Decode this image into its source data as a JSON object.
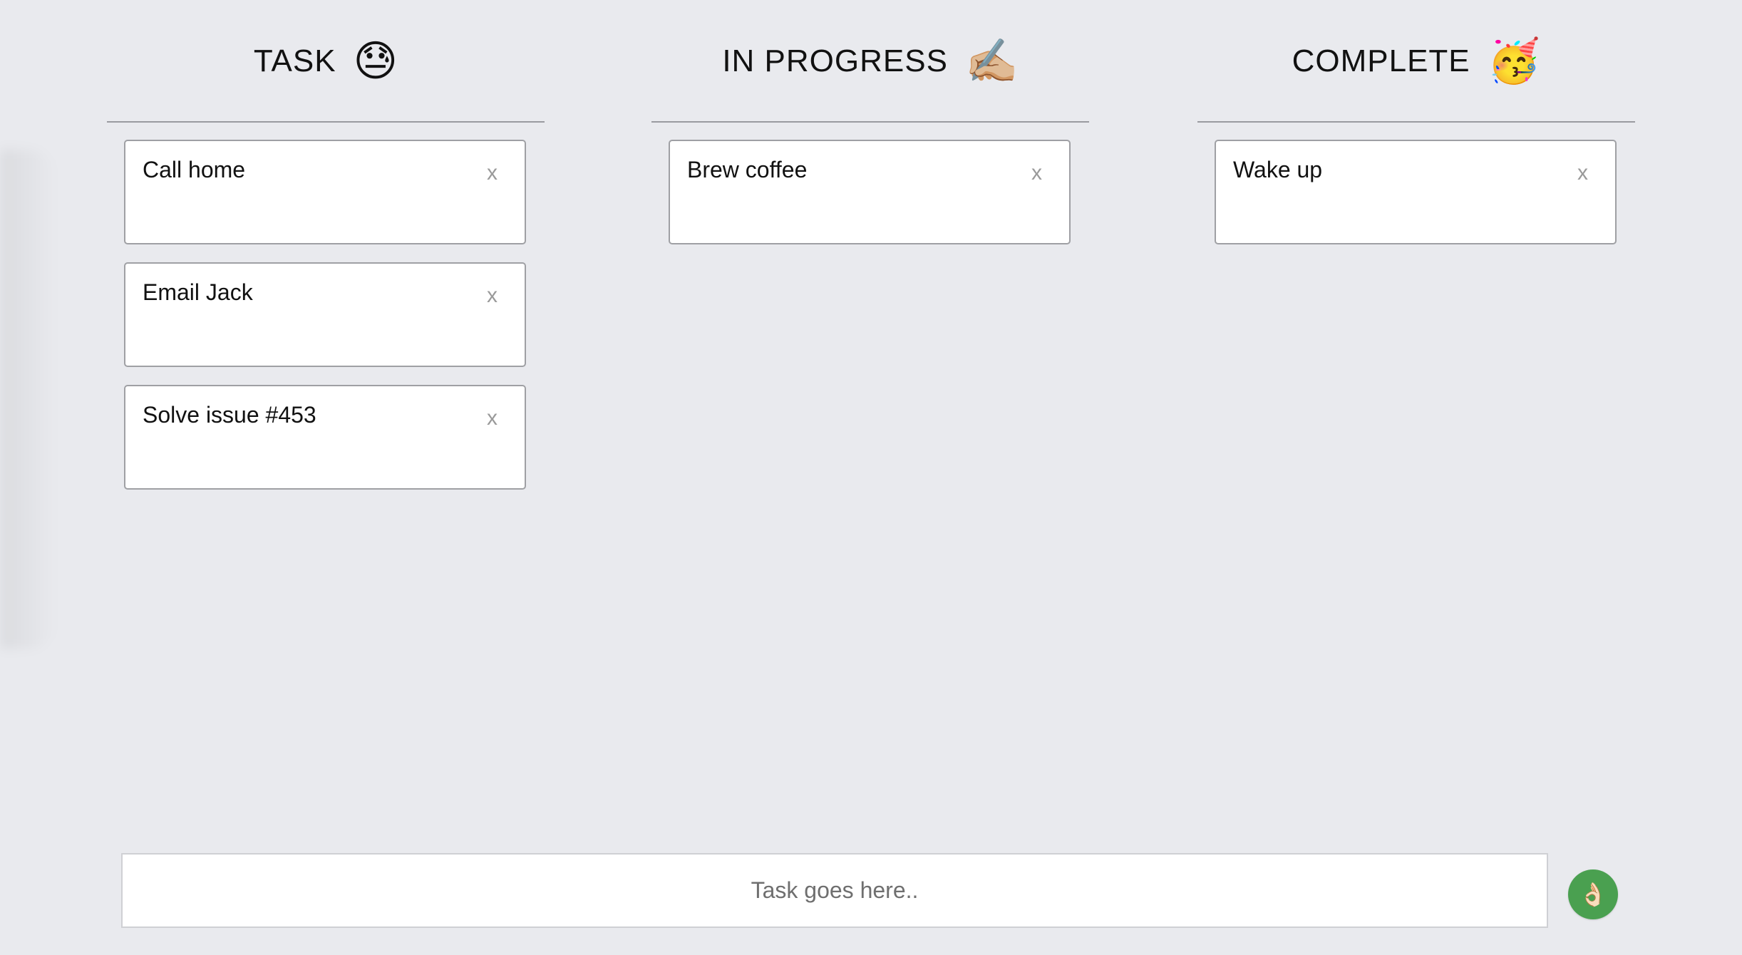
{
  "columns": [
    {
      "title": "TASK",
      "emoji": "😓",
      "cards": [
        "Call home",
        "Email Jack",
        "Solve issue #453"
      ]
    },
    {
      "title": "IN PROGRESS",
      "emoji": "✍🏼",
      "cards": [
        "Brew coffee"
      ]
    },
    {
      "title": "COMPLETE",
      "emoji": "🥳",
      "cards": [
        "Wake up"
      ]
    }
  ],
  "card_close_label": "x",
  "input": {
    "placeholder": "Task goes here..",
    "value": ""
  },
  "submit_button": {
    "icon": "👌🏻",
    "icon_name": "ok-hand-icon",
    "color": "#4aa050"
  }
}
